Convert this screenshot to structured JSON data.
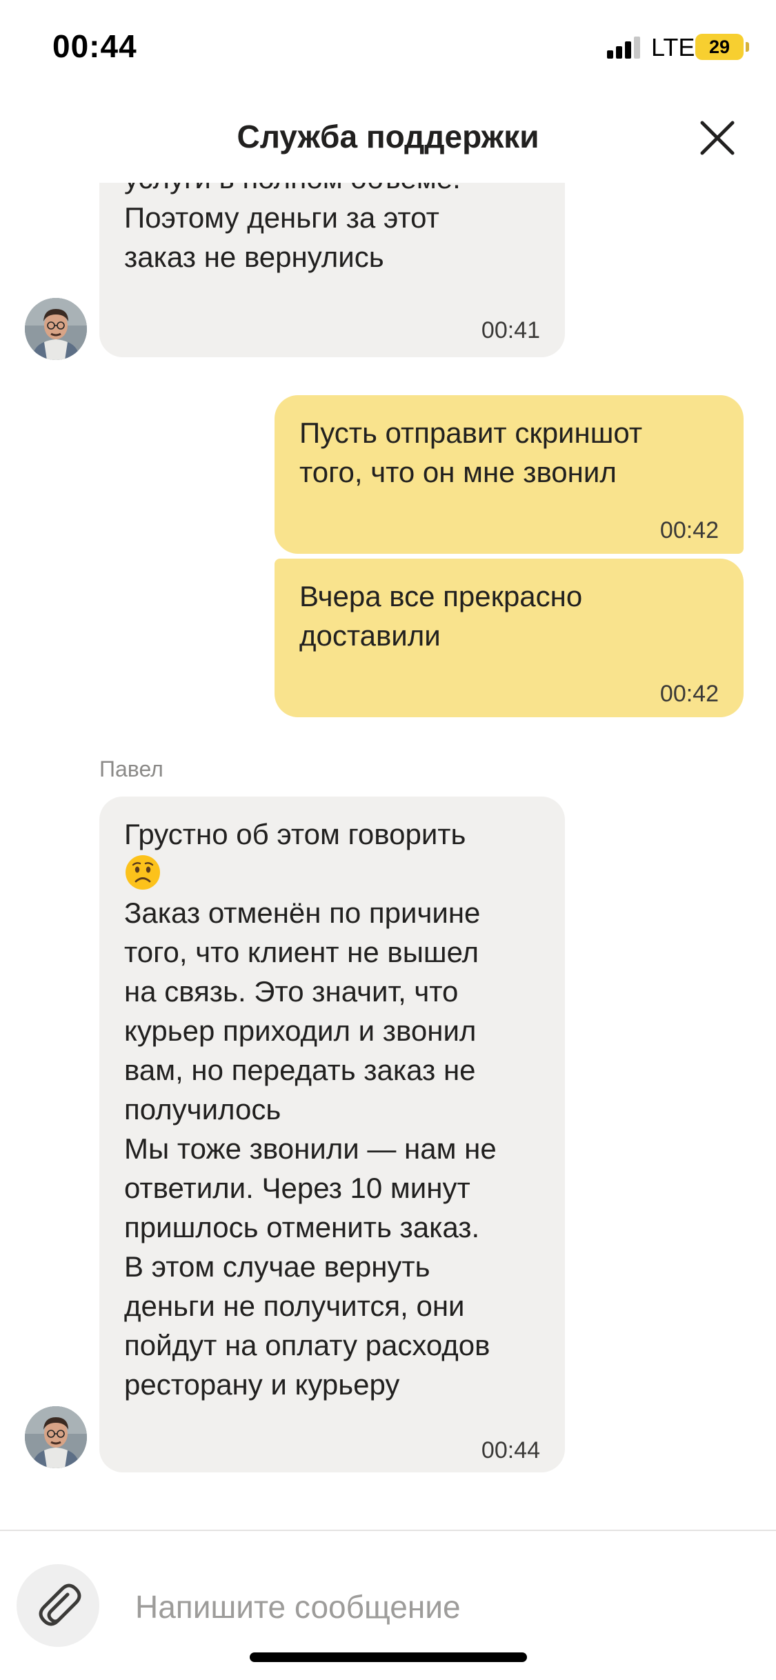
{
  "status_bar": {
    "time": "00:44",
    "network": "LTE",
    "battery": "29"
  },
  "header": {
    "title": "Служба поддержки"
  },
  "messages": [
    {
      "direction": "incoming",
      "text": "услуги в полном объёме.\nПоэтому деньги за этот\nзаказ не вернулись",
      "time": "00:41"
    },
    {
      "direction": "outgoing",
      "text": "Пусть отправит скриншот\nтого, что он мне звонил",
      "time": "00:42"
    },
    {
      "direction": "outgoing",
      "text": "Вчера все прекрасно\nдоставили",
      "time": "00:42"
    },
    {
      "direction": "incoming",
      "sender": "Павел",
      "text_intro": "Грустно об этом говорить",
      "emoji": "worried-face-emoji",
      "text": "Заказ отменён по причине\nтого, что клиент не вышел\nна связь. Это значит, что\nкурьер приходил и звонил\nвам, но передать заказ не\nполучилось\nМы тоже звонили — нам не\nответили. Через 10 минут\nпришлось отменить заказ.\nВ этом случае вернуть\nденьги не получится, они\nпойдут на оплату расходов\nресторану и курьеру",
      "time": "00:44"
    }
  ],
  "composer": {
    "placeholder": "Напишите сообщение",
    "attach_icon": "paperclip-icon"
  },
  "colors": {
    "incoming_bubble": "#f1f0ee",
    "outgoing_bubble": "#f9e38d",
    "battery": "#f7cf30"
  }
}
